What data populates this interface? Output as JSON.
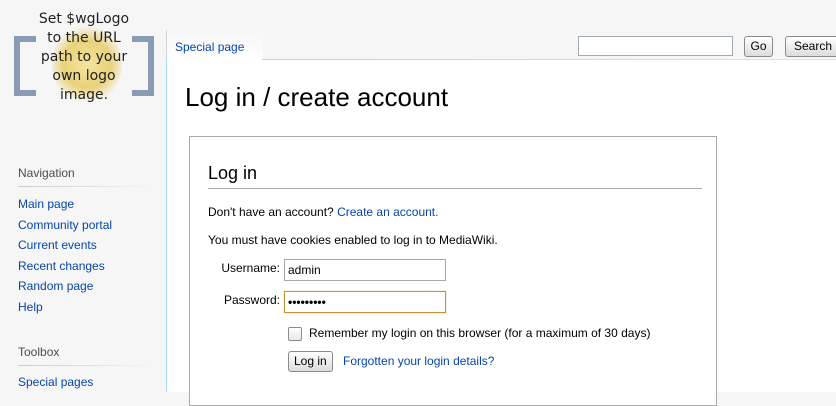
{
  "logo": {
    "text_lines": [
      "Set $wgLogo",
      "to the URL",
      "path to your",
      "own logo",
      "image."
    ]
  },
  "sidebar": {
    "navigation_title": "Navigation",
    "navigation_items": [
      "Main page",
      "Community portal",
      "Current events",
      "Recent changes",
      "Random page",
      "Help"
    ],
    "toolbox_title": "Toolbox",
    "toolbox_items": [
      "Special pages"
    ]
  },
  "tabs": {
    "special_page": "Special page"
  },
  "search": {
    "value": "",
    "go_label": "Go",
    "search_label": "Search"
  },
  "page": {
    "title": "Log in / create account"
  },
  "login": {
    "heading": "Log in",
    "no_account_text": "Don't have an account?",
    "create_account_link": "Create an account.",
    "cookies_text": "You must have cookies enabled to log in to MediaWiki.",
    "username_label": "Username:",
    "username_value": "admin",
    "password_label": "Password:",
    "password_value": "•••••••••",
    "remember_label": "Remember my login on this browser (for a maximum of 30 days)",
    "remember_checked": false,
    "login_button": "Log in",
    "forgot_link": "Forgotten your login details?"
  },
  "colors": {
    "link": "#0645ad",
    "focus_border": "#c89234"
  }
}
